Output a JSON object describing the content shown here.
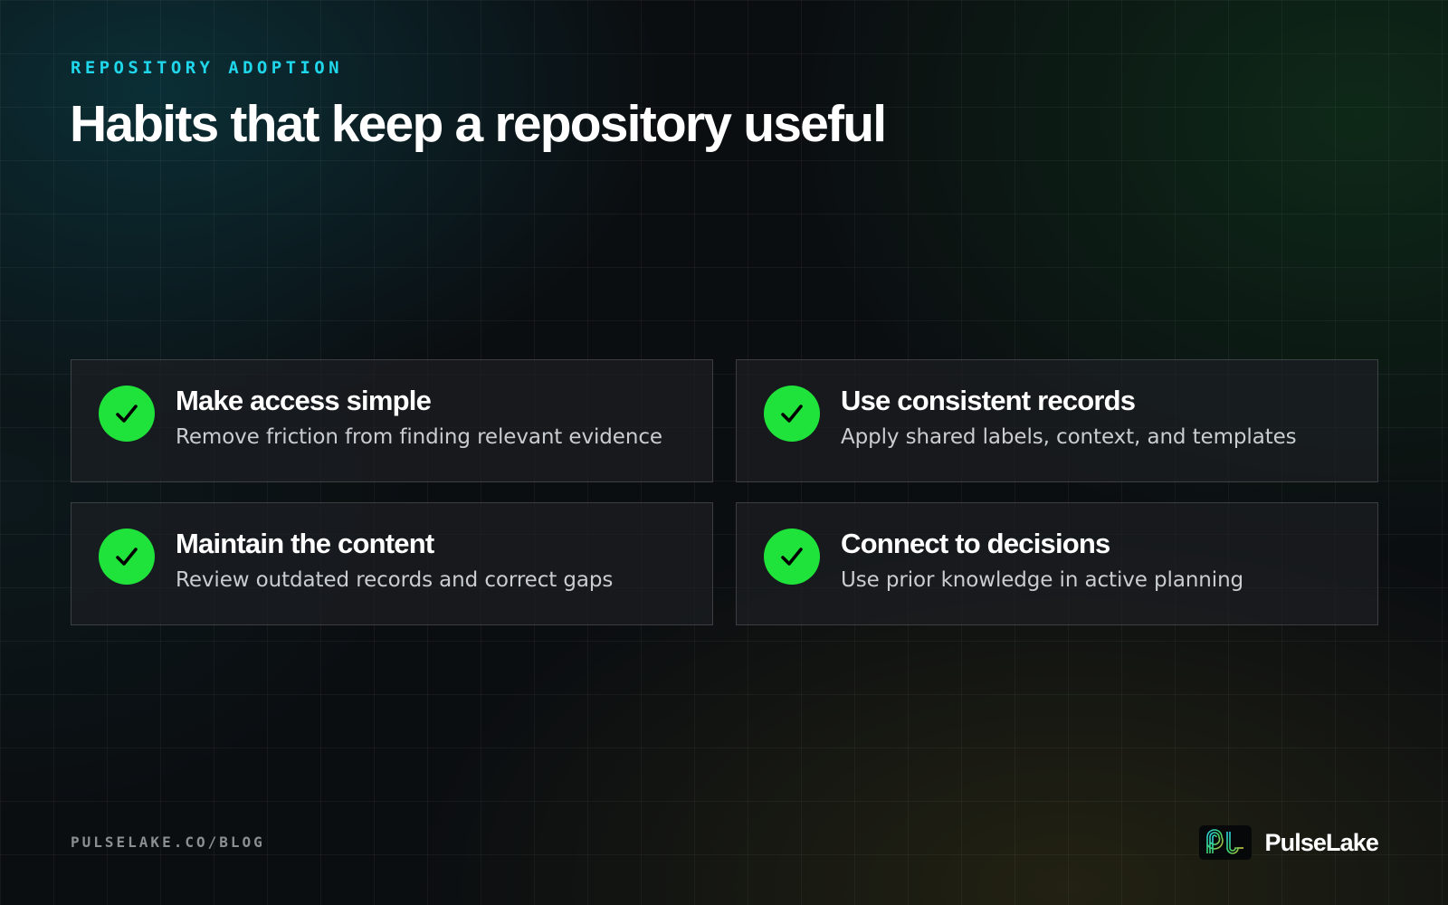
{
  "header": {
    "eyebrow": "REPOSITORY ADOPTION",
    "title": "Habits that keep a repository useful"
  },
  "cards": [
    {
      "icon": "check-icon",
      "title": "Make access simple",
      "description": "Remove friction from finding relevant evidence"
    },
    {
      "icon": "check-icon",
      "title": "Use consistent records",
      "description": "Apply shared labels, context, and templates"
    },
    {
      "icon": "check-icon",
      "title": "Maintain the content",
      "description": "Review outdated records and correct gaps"
    },
    {
      "icon": "check-icon",
      "title": "Connect to decisions",
      "description": "Use prior knowledge in active planning"
    }
  ],
  "footer": {
    "url": "PULSELAKE.CO/BLOG",
    "brand_name": "PulseLake",
    "logo_icon": "pulselake-logo-icon"
  },
  "colors": {
    "background": "#0b0e11",
    "accent_cyan": "#1fd6ea",
    "check_green": "#1fe33a",
    "card_border": "#3a3d41",
    "muted_text": "#c9cdd1"
  }
}
